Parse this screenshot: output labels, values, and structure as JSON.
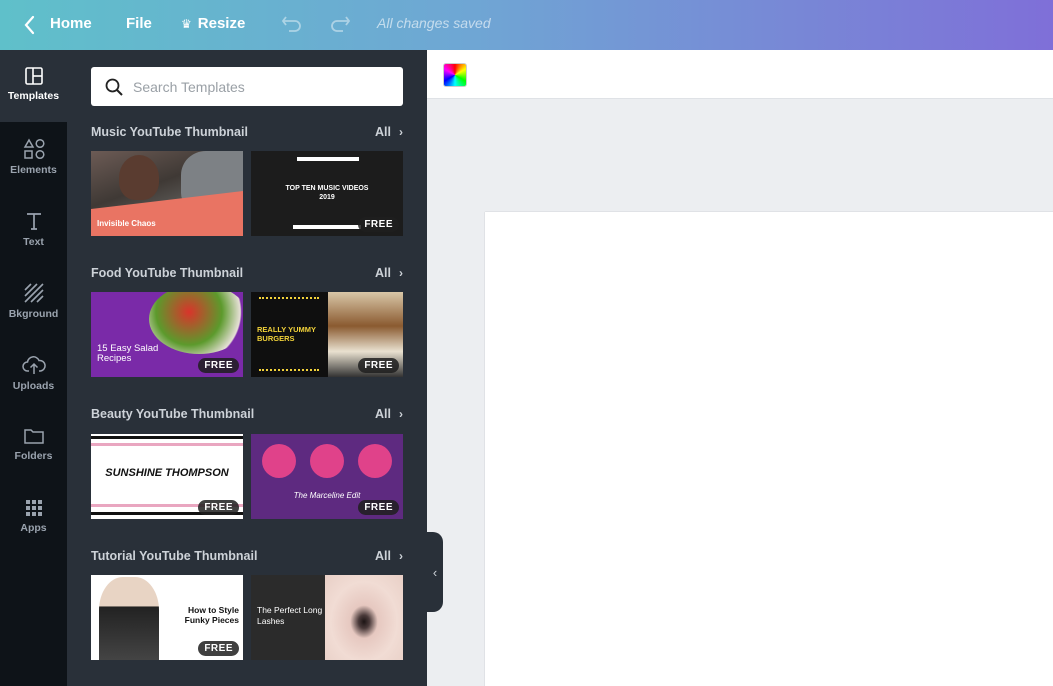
{
  "topbar": {
    "home_label": "Home",
    "file_label": "File",
    "resize_label": "Resize",
    "crown_glyph": "♛",
    "save_status": "All changes saved"
  },
  "rail": {
    "items": [
      {
        "label": "Templates",
        "icon": "templates-icon"
      },
      {
        "label": "Elements",
        "icon": "elements-icon"
      },
      {
        "label": "Text",
        "icon": "text-icon"
      },
      {
        "label": "Bkground",
        "icon": "background-icon"
      },
      {
        "label": "Uploads",
        "icon": "uploads-icon"
      },
      {
        "label": "Folders",
        "icon": "folder-icon"
      },
      {
        "label": "Apps",
        "icon": "apps-icon"
      }
    ]
  },
  "search": {
    "placeholder": "Search Templates"
  },
  "sections": [
    {
      "title": "Music YouTube Thumbnail",
      "all_label": "All"
    },
    {
      "title": "Food YouTube Thumbnail",
      "all_label": "All"
    },
    {
      "title": "Beauty YouTube Thumbnail",
      "all_label": "All"
    },
    {
      "title": "Tutorial YouTube Thumbnail",
      "all_label": "All"
    }
  ],
  "thumbs": {
    "music1": {
      "title": "Invisible Chaos"
    },
    "music2": {
      "title": "TOP TEN MUSIC VIDEOS 2019",
      "badge": "FREE"
    },
    "food1": {
      "title": "15 Easy Salad Recipes",
      "badge": "FREE"
    },
    "food2": {
      "title": "REALLY YUMMY BURGERS",
      "badge": "FREE"
    },
    "beauty1": {
      "title": "SUNSHINE THOMPSON",
      "badge": "FREE"
    },
    "beauty2": {
      "title": "The Marceline Edit",
      "badge": "FREE"
    },
    "tut1": {
      "title": "How to Style Funky Pieces",
      "badge": "FREE"
    },
    "tut2": {
      "title": "The Perfect Long Lashes"
    }
  },
  "colors": {
    "accent": "#7f6fd8",
    "panel": "#293039",
    "rail": "#0e1318"
  }
}
